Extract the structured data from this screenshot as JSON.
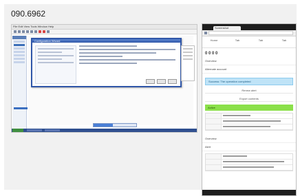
{
  "header": {
    "code": "090.6962"
  },
  "desktop": {
    "menu_text": "File  Edit  View  Tools  Window  Help",
    "dialog_title": "Configuration Wizard",
    "progress_fraction": 0.45
  },
  "phone": {
    "tab_label": "Screenshot",
    "nav_items": [
      "Home",
      "Tab",
      "Tab",
      "Tab"
    ],
    "heading": "0 0 0 0",
    "sections": [
      "Overview",
      "Alternate account"
    ],
    "blue_banner": "Success: The operation completed",
    "line_items": [
      "Renew alert",
      "Export contents"
    ],
    "green_badge": "Active",
    "section_footer": "Overview",
    "footer_label": "Alert"
  },
  "colors": {
    "accent_blue": "#2f56a8",
    "green": "#8be04a",
    "banner_blue": "#bfe3f7"
  }
}
